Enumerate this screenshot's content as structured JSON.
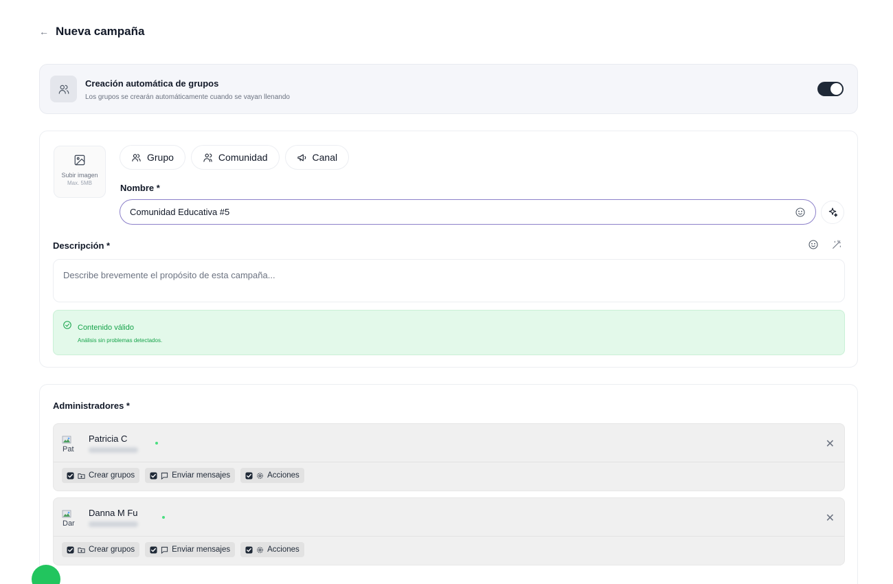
{
  "header": {
    "back_icon": "arrow-left-icon",
    "title": "Nueva campaña"
  },
  "auto_groups": {
    "icon": "users-icon",
    "title": "Creación automática de grupos",
    "subtitle": "Los grupos se crearán automáticamente cuando se vayan llenando",
    "toggle_on": true,
    "toggle_color": "#1f2937"
  },
  "upload": {
    "icon": "image-icon",
    "label": "Subir imagen",
    "max": "Max. 5MB"
  },
  "types": [
    {
      "label": "Grupo",
      "icon": "users-icon"
    },
    {
      "label": "Comunidad",
      "icon": "community-icon"
    },
    {
      "label": "Canal",
      "icon": "megaphone-icon"
    }
  ],
  "name": {
    "label": "Nombre *",
    "value": "Comunidad Educativa #5",
    "border_color": "#8b7fc9"
  },
  "description": {
    "label": "Descripción *",
    "placeholder": "Describe brevemente el propósito de esta campaña..."
  },
  "validation": {
    "title": "Contenido válido",
    "subtitle": "Análisis sin problemas detectados.",
    "color": "#16a34a",
    "background": "#e3f9ea"
  },
  "admins": {
    "label": "Administradores *",
    "items": [
      {
        "name": "Patricia C",
        "avatar_alt": "Pat",
        "permissions": [
          "Crear grupos",
          "Enviar mensajes",
          "Acciones"
        ]
      },
      {
        "name": "Danna M Fu",
        "avatar_alt": "Dar",
        "permissions": [
          "Crear grupos",
          "Enviar mensajes",
          "Acciones"
        ]
      }
    ]
  },
  "accent_green": "#22c55e"
}
